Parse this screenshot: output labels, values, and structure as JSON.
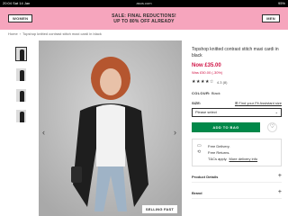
{
  "status_bar": {
    "time": "20:04",
    "date": "Sat 14 Jan",
    "url": "asos.com",
    "battery": "95%"
  },
  "promo": {
    "women_label": "WOMEN",
    "men_label": "MEN",
    "line1": "SALE: FINAL REDUCTIONS!",
    "line2": "UP TO 80% OFF ALREADY"
  },
  "breadcrumb": {
    "home": "Home",
    "current": "Topshop knitted contrast stitch maxi cardi in black"
  },
  "gallery": {
    "selling_fast": "SELLING FAST"
  },
  "product": {
    "title": "Topshop knitted contrast stitch maxi cardi in black",
    "price": "Now £35.00",
    "was_price": "Was £50.00 (-30%)",
    "rating_value": "4.3 (8)",
    "colour_label": "COLOUR:",
    "colour_value": "Black",
    "size_label": "SIZE:",
    "fit_assistant": "Find your Fit Assistant size",
    "size_placeholder": "Please select",
    "add_to_bag": "ADD TO BAG",
    "free_delivery": "Free Delivery.",
    "free_returns": "Free Returns.",
    "ts_cs": "T&Cs apply.",
    "more_delivery": "More delivery info",
    "product_details": "Product Details",
    "brand": "Brand"
  },
  "colors": {
    "promo_bg": "#f6a5bd",
    "accent_green": "#018849",
    "sale_red": "#d01345"
  }
}
